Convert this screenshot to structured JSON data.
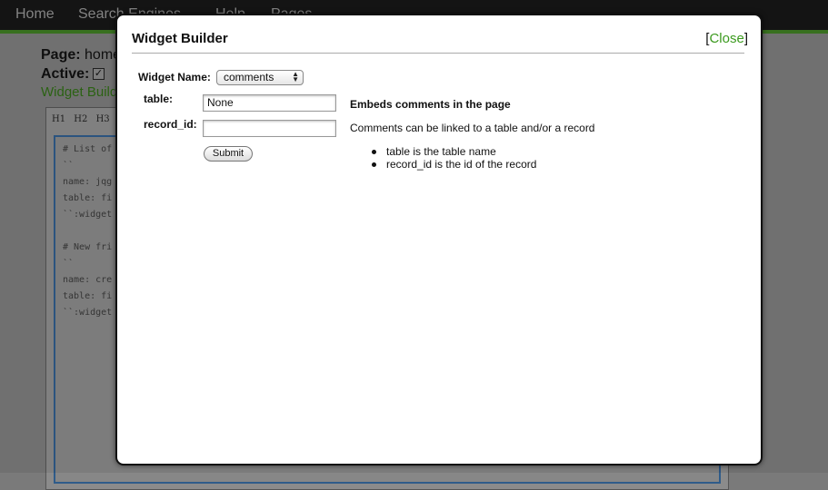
{
  "topnav": {
    "items": [
      "Home",
      "Search Engines",
      "Help",
      "Pages"
    ]
  },
  "background": {
    "page_label": "Page:",
    "page_value": "home",
    "active_label": "Active:",
    "active_checked": true,
    "widget_builder_link": "Widget Builder",
    "toolbar": [
      "H1",
      "H2",
      "H3"
    ],
    "code_lines": [
      "# List of",
      "``",
      "name: jqg",
      "table: fi",
      "``:widget",
      "",
      "# New fri",
      "``",
      "name: cre",
      "table: fi",
      "``:widget"
    ]
  },
  "modal": {
    "title": "Widget Builder",
    "close_bracket_open": "[",
    "close_label": "Close",
    "close_bracket_end": "]",
    "widget_name_label": "Widget Name:",
    "widget_name_selected": "comments",
    "fields": [
      {
        "label": "table:",
        "value": "None"
      },
      {
        "label": "record_id:",
        "value": ""
      }
    ],
    "submit_label": "Submit",
    "description_title": "Embeds comments in the page",
    "description_text": "Comments can be linked to a table and/or a record",
    "description_bullets": [
      "table is the table name",
      "record_id is the id of the record"
    ]
  }
}
